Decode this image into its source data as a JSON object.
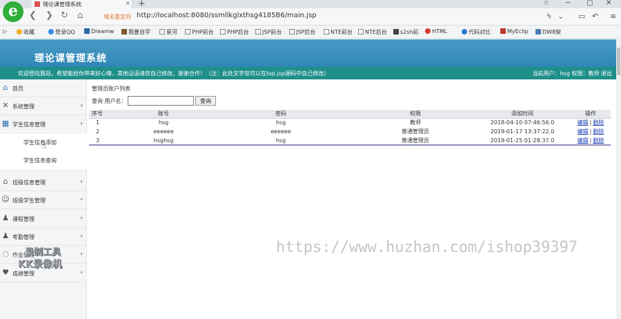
{
  "browser": {
    "tab_title": "理论课管理系统",
    "tab_close": "×",
    "new_tab": "+",
    "address_badge": "域名重定向",
    "url": "http://localhost:8080/ssmllkglxthsg4185B6/main.jsp",
    "window_controls": [
      "☆",
      "─",
      "▢",
      "✕"
    ],
    "bookmarks": [
      {
        "label": "收藏",
        "icon": "star-icon",
        "color": "#f2b01e"
      },
      {
        "label": "登录QQ",
        "icon": "qq-icon",
        "color": "#3a8de0"
      },
      {
        "label": "Dreamw",
        "icon": "dreamweaver-icon",
        "color": "#2d6aa8"
      },
      {
        "label": "我要自学",
        "icon": "book-icon",
        "color": "#7a5a2a"
      },
      {
        "label": "星河",
        "icon": "page-icon",
        "color": "#888888"
      },
      {
        "label": "PHP前台",
        "icon": "page-icon",
        "color": "#888888"
      },
      {
        "label": "PHP后台",
        "icon": "page-icon",
        "color": "#888888"
      },
      {
        "label": "JSP前台",
        "icon": "page-icon",
        "color": "#888888"
      },
      {
        "label": "JSP后台",
        "icon": "page-icon",
        "color": "#888888"
      },
      {
        "label": "NTE前台",
        "icon": "page-icon",
        "color": "#888888"
      },
      {
        "label": "NTE后台",
        "icon": "page-icon",
        "color": "#888888"
      },
      {
        "label": "s2sh前",
        "icon": "page-icon",
        "color": "#444444"
      },
      {
        "label": "HTML",
        "icon": "html-icon",
        "color": "#d23a2a"
      },
      {
        "label": "代码对比",
        "icon": "compare-icon",
        "color": "#2a7ad2"
      },
      {
        "label": "MyEclip",
        "icon": "myeclipse-icon",
        "color": "#c0392b"
      },
      {
        "label": "DW8架",
        "icon": "home-icon",
        "color": "#4a7ab0"
      }
    ]
  },
  "header": {
    "title": "理论课管理系统",
    "notice": "欢迎登陆我站，希望能给你带来好心情，其他话语请您自己修改，谢谢合作！（注：此处文字您可以在top.jsp源码中自己修改）",
    "user_info": "当前用户：hsg 权限：教师 退出"
  },
  "sidebar": {
    "items": [
      {
        "label": "首页",
        "icon": "home-icon"
      },
      {
        "label": "系统管理",
        "icon": "tools-icon"
      },
      {
        "label": "学生信息管理",
        "icon": "grid-icon"
      },
      {
        "label": "班级信息管理",
        "icon": "house-icon"
      },
      {
        "label": "班级学生管理",
        "icon": "users-icon"
      },
      {
        "label": "课程管理",
        "icon": "user-icon"
      },
      {
        "label": "考勤管理",
        "icon": "user-icon"
      },
      {
        "label": "作业管理",
        "icon": "chat-icon"
      },
      {
        "label": "成绩管理",
        "icon": "heart-icon"
      }
    ],
    "subitems": [
      {
        "label": "学生信息添加"
      },
      {
        "label": "学生信息查询"
      }
    ]
  },
  "content": {
    "title": "管理员账户列表",
    "search_label": "查询 用户名：",
    "search_value": "",
    "search_button": "查询",
    "columns": [
      "序号",
      "账号",
      "密码",
      "权限",
      "添加时间",
      "操作"
    ],
    "rows": [
      {
        "id": "1",
        "account": "hsg",
        "password": "hsg",
        "role": "教师",
        "time": "2018-04-10 07:46:56.0",
        "edit": "编辑",
        "sep": "|",
        "delete": "删除"
      },
      {
        "id": "2",
        "account": "eeeeee",
        "password": "eeeeee",
        "role": "普通管理员",
        "time": "2019-01-17 13:37:22.0",
        "edit": "编辑",
        "sep": "|",
        "delete": "删除"
      },
      {
        "id": "3",
        "account": "hsghsg",
        "password": "hsg",
        "role": "普通管理员",
        "time": "2019-01-25 01:28:37.0",
        "edit": "编辑",
        "sep": "|",
        "delete": "删除"
      }
    ]
  },
  "overlay": {
    "watermark": "https://www.huzhan.com/ishop39397",
    "recorder_line1": "录制工具",
    "recorder_line2": "KK录像机"
  },
  "colors": {
    "header_blue": "#3a90c0",
    "notice_teal": "#1f8f8a",
    "link_blue": "#1a3fb0"
  }
}
